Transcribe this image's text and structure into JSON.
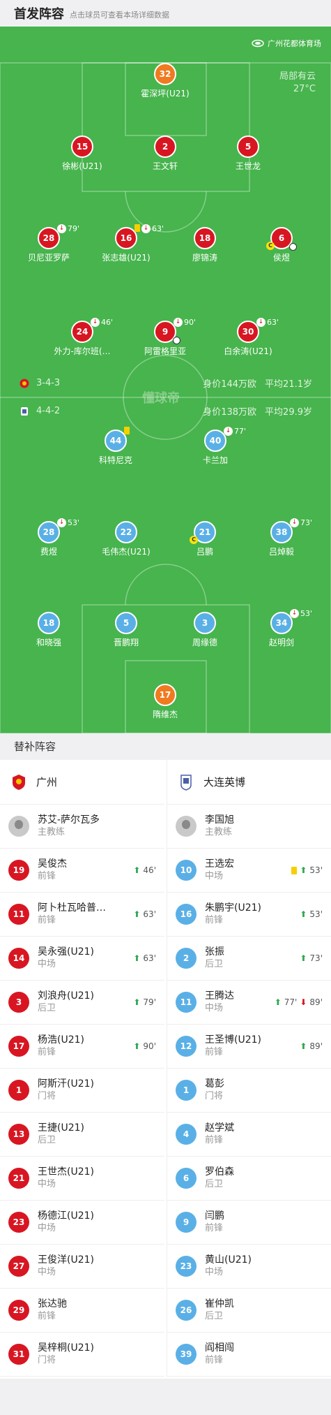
{
  "header": {
    "title": "首发阵容",
    "hint": "点击球员可查看本场详细数据"
  },
  "venue": "广州花都体育场",
  "weather": {
    "desc": "局部有云",
    "temp": "27°C"
  },
  "watermark": "懂球帝",
  "home": {
    "formation": "3-4-3",
    "value": "身价144万欧",
    "age": "平均21.1岁"
  },
  "away": {
    "formation": "4-4-2",
    "value": "身价138万欧",
    "age": "平均29.9岁"
  },
  "home_players": [
    {
      "num": "32",
      "name": "霍深坪(U21)"
    },
    {
      "num": "15",
      "name": "徐彬(U21)"
    },
    {
      "num": "2",
      "name": "王文轩"
    },
    {
      "num": "5",
      "name": "王世龙"
    },
    {
      "num": "28",
      "name": "贝尼亚罗萨",
      "min": "79'"
    },
    {
      "num": "16",
      "name": "张志雄(U21)",
      "min": "63'"
    },
    {
      "num": "18",
      "name": "廖锦涛"
    },
    {
      "num": "6",
      "name": "侯煜"
    },
    {
      "num": "24",
      "name": "外力-库尔班(…",
      "min": "46'"
    },
    {
      "num": "9",
      "name": "阿雷格里亚",
      "min": "90'"
    },
    {
      "num": "30",
      "name": "白余涛(U21)",
      "min": "63'"
    }
  ],
  "away_players": [
    {
      "num": "44",
      "name": "科特尼克"
    },
    {
      "num": "40",
      "name": "卡兰加",
      "min": "77'"
    },
    {
      "num": "28",
      "name": "费煜",
      "min": "53'"
    },
    {
      "num": "22",
      "name": "毛伟杰(U21)"
    },
    {
      "num": "21",
      "name": "吕鹏"
    },
    {
      "num": "38",
      "name": "吕焯毅",
      "min": "73'"
    },
    {
      "num": "18",
      "name": "和晓强"
    },
    {
      "num": "5",
      "name": "晋鹏翔"
    },
    {
      "num": "3",
      "name": "周缘德"
    },
    {
      "num": "34",
      "name": "赵明剑",
      "min": "53'"
    },
    {
      "num": "17",
      "name": "隋维杰"
    }
  ],
  "subs_title": "替补阵容",
  "teams": {
    "left": "广州",
    "right": "大连英博"
  },
  "coaches": {
    "left": {
      "name": "苏艾-萨尔瓦多",
      "role": "主教练"
    },
    "right": {
      "name": "李国旭",
      "role": "主教练"
    }
  },
  "left_subs": [
    {
      "num": "19",
      "name": "吴俊杰",
      "pos": "前锋",
      "ev": "46'"
    },
    {
      "num": "11",
      "name": "阿卜杜瓦哈普…",
      "pos": "前锋",
      "ev": "63'"
    },
    {
      "num": "14",
      "name": "吴永强(U21)",
      "pos": "中场",
      "ev": "63'"
    },
    {
      "num": "3",
      "name": "刘浪舟(U21)",
      "pos": "后卫",
      "ev": "79'"
    },
    {
      "num": "17",
      "name": "杨浩(U21)",
      "pos": "前锋",
      "ev": "90'"
    },
    {
      "num": "1",
      "name": "阿斯汗(U21)",
      "pos": "门将"
    },
    {
      "num": "13",
      "name": "王捷(U21)",
      "pos": "后卫"
    },
    {
      "num": "21",
      "name": "王世杰(U21)",
      "pos": "中场"
    },
    {
      "num": "23",
      "name": "杨德江(U21)",
      "pos": "中场"
    },
    {
      "num": "27",
      "name": "王俊洋(U21)",
      "pos": "中场"
    },
    {
      "num": "29",
      "name": "张达驰",
      "pos": "前锋"
    },
    {
      "num": "31",
      "name": "吴梓桐(U21)",
      "pos": "门将"
    }
  ],
  "right_subs": [
    {
      "num": "10",
      "name": "王选宏",
      "pos": "中场",
      "ev": "53'"
    },
    {
      "num": "16",
      "name": "朱鹏宇(U21)",
      "pos": "前锋",
      "ev": "53'"
    },
    {
      "num": "2",
      "name": "张振",
      "pos": "后卫",
      "ev": "73'"
    },
    {
      "num": "11",
      "name": "王腾达",
      "pos": "中场",
      "ev": "77'",
      "ev2": "89'"
    },
    {
      "num": "12",
      "name": "王圣博(U21)",
      "pos": "前锋",
      "ev": "89'"
    },
    {
      "num": "1",
      "name": "葛彭",
      "pos": "门将"
    },
    {
      "num": "4",
      "name": "赵学斌",
      "pos": "前锋"
    },
    {
      "num": "6",
      "name": "罗伯森",
      "pos": "后卫"
    },
    {
      "num": "9",
      "name": "闫鹏",
      "pos": "前锋"
    },
    {
      "num": "23",
      "name": "黄山(U21)",
      "pos": "中场"
    },
    {
      "num": "26",
      "name": "崔仲凯",
      "pos": "后卫"
    },
    {
      "num": "39",
      "name": "阎相闯",
      "pos": "前锋"
    }
  ],
  "colors": {
    "home": "#d81622",
    "away": "#5ab0e6",
    "goalkeeper": "#f07a1f",
    "pitch": "#47b44d"
  }
}
